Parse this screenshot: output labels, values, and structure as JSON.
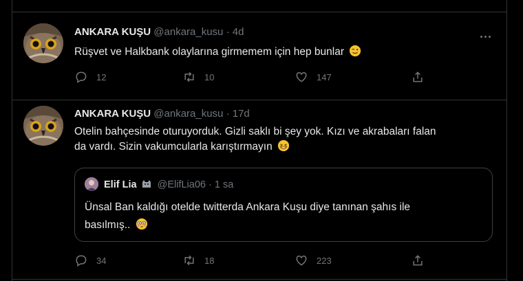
{
  "tweets": [
    {
      "author": {
        "name": "ANKARA KUŞU",
        "handle": "@ankara_kusu"
      },
      "separator": "·",
      "time": "4d",
      "text": "Rüşvet ve Halkbank olaylarına girmemem için hep bunlar",
      "emoji": "winking-face",
      "stats": {
        "replies": "12",
        "retweets": "10",
        "likes": "147"
      }
    },
    {
      "author": {
        "name": "ANKARA KUŞU",
        "handle": "@ankara_kusu"
      },
      "separator": "·",
      "time": "17d",
      "text_line1": "Otelin bahçesinde oturuyorduk. Gizli saklı bi şey yok. Kızı ve akrabaları falan",
      "text_line2": "da vardı. Sizin vakumcularla karıştırmayın",
      "emoji": "grinning-face",
      "quote": {
        "author": {
          "name": "Elif Lia",
          "handle": "@ElifLia06"
        },
        "separator": "·",
        "time": "1 sa",
        "text_line1": "Ünsal Ban kaldığı otelde twitterda Ankara Kuşu diye tanınan şahıs ile",
        "text_line2": "basılmış..",
        "emoji": "flushed-face"
      },
      "stats": {
        "replies": "34",
        "retweets": "18",
        "likes": "223"
      }
    }
  ],
  "colors": {
    "background": "#000000",
    "text": "#e7e9ea",
    "muted": "#71767b",
    "border": "#2f3336"
  },
  "icons": [
    "reply-icon",
    "retweet-icon",
    "like-icon",
    "share-icon",
    "more-icon",
    "cat-icon"
  ]
}
